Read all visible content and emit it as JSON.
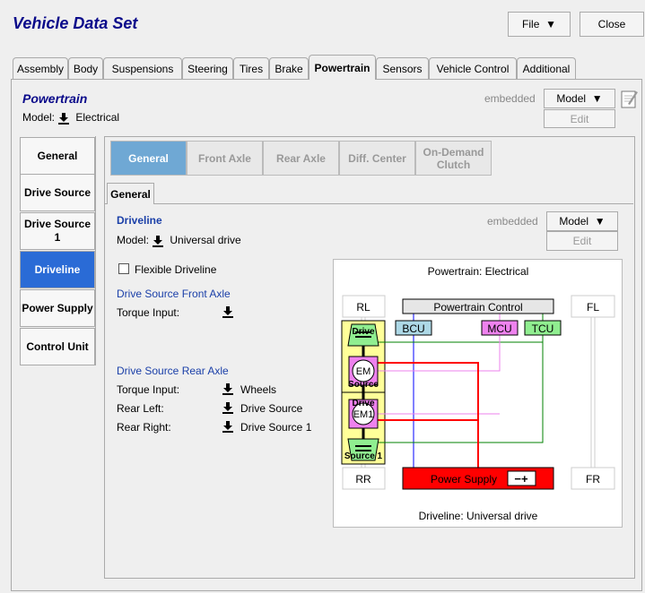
{
  "window": {
    "title": "Vehicle Data Set",
    "file_label": "File",
    "close_label": "Close"
  },
  "tabs": [
    "Assembly",
    "Body",
    "Suspensions",
    "Steering",
    "Tires",
    "Brake",
    "Powertrain",
    "Sensors",
    "Vehicle Control",
    "Additional"
  ],
  "powertrain": {
    "title": "Powertrain",
    "model_label": "Model:",
    "model_value": "Electrical",
    "embedded": "embedded",
    "model_button": "Model",
    "edit_button": "Edit"
  },
  "nav": [
    "General",
    "Drive Source",
    "Drive Source 1",
    "Driveline",
    "Power Supply",
    "Control Unit"
  ],
  "inner_tabs": [
    "General",
    "Front Axle",
    "Rear Axle",
    "Diff. Center",
    "On-Demand Clutch"
  ],
  "sub_tab": "General",
  "driveline": {
    "title": "Driveline",
    "model_label": "Model:",
    "model_value": "Universal drive",
    "embedded": "embedded",
    "model_button": "Model",
    "edit_button": "Edit",
    "flexible_label": "Flexible Driveline",
    "flexible_checked": false,
    "front_title": "Drive Source Front Axle",
    "front_torque_label": "Torque Input:",
    "rear_title": "Drive Source Rear Axle",
    "rear_rows": [
      {
        "label": "Torque Input:",
        "value": "Wheels"
      },
      {
        "label": "Rear Left:",
        "value": "Drive Source"
      },
      {
        "label": "Rear Right:",
        "value": "Drive Source 1"
      }
    ]
  },
  "diagram": {
    "title": "Powertrain: Electrical",
    "footer": "Driveline: Universal drive",
    "rl": "RL",
    "rr": "RR",
    "fl": "FL",
    "fr": "FR",
    "control": "Powertrain Control",
    "bcu": "BCU",
    "mcu": "MCU",
    "tcu": "TCU",
    "power_supply": "Power Supply",
    "em": "EM",
    "em1": "EM1",
    "drive": "Drive",
    "source": "Source",
    "drive2": "Drive",
    "source1": "Source 1",
    "battery": "−+"
  },
  "colors": {
    "accent": "#2a6bd6",
    "title": "#0a0a8a",
    "power_supply": "#ff0000",
    "bcu": "#add8e6",
    "mcu": "#ee82ee",
    "tcu": "#90ee90"
  }
}
